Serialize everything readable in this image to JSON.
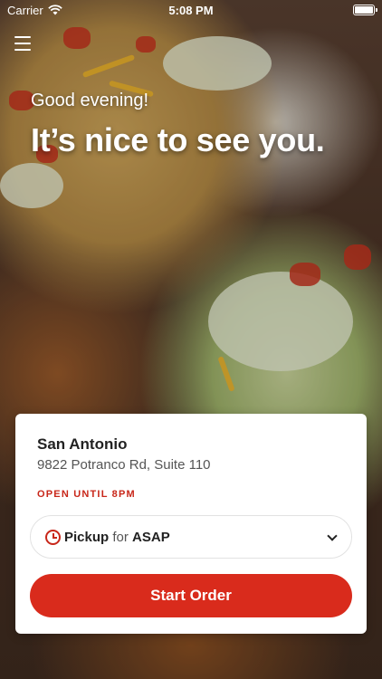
{
  "status_bar": {
    "carrier": "Carrier",
    "time": "5:08 PM"
  },
  "header": {
    "greeting": "Good evening!",
    "headline": "It’s nice to see you."
  },
  "location": {
    "name": "San Antonio",
    "address": "9822 Potranco Rd, Suite 110",
    "hours": "OPEN UNTIL 8PM"
  },
  "order_mode": {
    "type": "Pickup",
    "connector": "for",
    "time": "ASAP"
  },
  "start_button_label": "Start Order",
  "colors": {
    "accent": "#d92b1c",
    "hours_text": "#c8271a"
  },
  "icons": {
    "menu": "hamburger-menu-icon",
    "clock": "clock-icon",
    "chevron": "chevron-down-icon",
    "wifi": "wifi-icon",
    "battery": "battery-icon"
  }
}
